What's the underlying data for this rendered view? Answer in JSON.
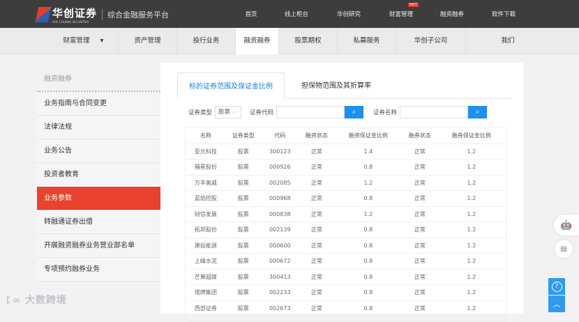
{
  "header": {
    "brand": "华创证券",
    "brand_en": "HUA CHUANG SECURITIES",
    "platform": "综合金融服务平台",
    "nav": [
      "首页",
      "线上柜台",
      "华创研究",
      "财富管理",
      "融资融券",
      "软件下载"
    ],
    "hot_badge": "HOT"
  },
  "main_nav": {
    "items": [
      "财富管理",
      "资产管理",
      "投行业务",
      "融资融券",
      "股票期权",
      "私募服务",
      "华创子公司",
      "我们"
    ],
    "active": "融资融券",
    "dropdown_icon": "▾"
  },
  "sidebar": {
    "title": "融资融券",
    "items": [
      "业务指南与合同变更",
      "法律法规",
      "业务公告",
      "投资者教育",
      "业务参数",
      "转融通证券出借",
      "开展融资融券业务营业部名单",
      "专项预约融券业务"
    ],
    "active": "业务参数"
  },
  "tabs": [
    "标的证券范围及保证金比例",
    "担保物范围及其折算率"
  ],
  "filters": {
    "type_label": "证券类型",
    "type_value": "股票",
    "code_label": "证券代码",
    "name_label": "证券名称",
    "search_icon": "⌕"
  },
  "table": {
    "headers": [
      "名称",
      "证券类型",
      "代码",
      "融资状态",
      "融资保证金比例",
      "融券状态",
      "融券保证金比例"
    ],
    "rows": [
      [
        "亚光科技",
        "股票",
        "300123",
        "正常",
        "1.4",
        "正常",
        "1.2"
      ],
      [
        "福星股份",
        "股票",
        "000926",
        "正常",
        "0.8",
        "正常",
        "1.2"
      ],
      [
        "万丰奥威",
        "股票",
        "002085",
        "正常",
        "1.2",
        "正常",
        "1.2"
      ],
      [
        "蓝焰控股",
        "股票",
        "000968",
        "正常",
        "0.8",
        "正常",
        "1.2"
      ],
      [
        "财信发展",
        "股票",
        "000838",
        "正常",
        "1.2",
        "正常",
        "1.2"
      ],
      [
        "拓邦股份",
        "股票",
        "002139",
        "正常",
        "0.8",
        "正常",
        "1.2"
      ],
      [
        "建投能源",
        "股票",
        "000600",
        "正常",
        "0.8",
        "正常",
        "1.2"
      ],
      [
        "上峰水泥",
        "股票",
        "000672",
        "正常",
        "0.8",
        "正常",
        "1.2"
      ],
      [
        "芒果超媒",
        "股票",
        "300413",
        "正常",
        "0.8",
        "正常",
        "1.2"
      ],
      [
        "塔牌集团",
        "股票",
        "002233",
        "正常",
        "0.8",
        "正常",
        "1.2"
      ],
      [
        "西部证券",
        "股票",
        "002673",
        "正常",
        "0.8",
        "正常",
        "1.2"
      ]
    ]
  },
  "float": {
    "help": "?",
    "top": "︿"
  },
  "watermark": "大数跨境",
  "colors": {
    "accent": "#e8432c",
    "blue": "#1e8fef",
    "topbar": "#3d3d3d"
  }
}
